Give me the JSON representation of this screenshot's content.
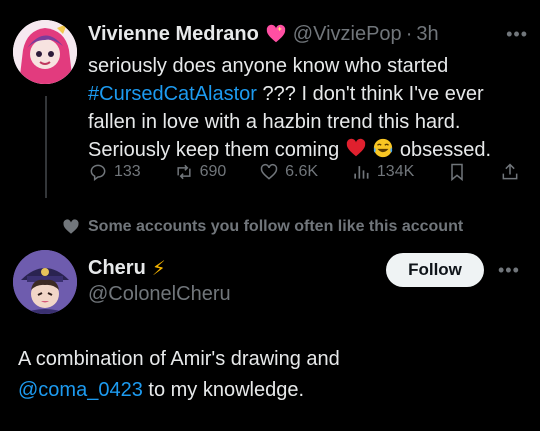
{
  "tweet": {
    "author_name": "Vivienne Medrano",
    "author_handle": "@VivziePop",
    "dot": "·",
    "time": "3h",
    "text_line1": "seriously does anyone know who started",
    "hashtag": "#CursedCatAlastor",
    "text_after_hashtag": " ??? I don't think I've ever fallen in love with a hazbin trend this hard. Seriously keep them coming ",
    "text_end": " obsessed.",
    "stats": {
      "replies": "133",
      "reposts": "690",
      "likes": "6.6K",
      "views": "134K"
    }
  },
  "social_context": "Some accounts you follow often like this account",
  "suggested_account": {
    "name": "Cheru",
    "name_emoji": "⚡",
    "handle": "@ColonelCheru",
    "follow_label": "Follow"
  },
  "bio": {
    "text_start": "A combination of Amir's drawing and ",
    "mention": "@coma_0423",
    "text_end": " to my knowledge."
  },
  "colors": {
    "accent": "#1d9bf0",
    "muted": "#71767b",
    "text": "#e7e9ea",
    "background": "#000000"
  },
  "icons": [
    "heart-badge-icon",
    "more-icon",
    "reply-icon",
    "repost-icon",
    "like-icon",
    "views-icon",
    "bookmark-icon",
    "share-icon",
    "heart-icon",
    "bolt-icon"
  ]
}
